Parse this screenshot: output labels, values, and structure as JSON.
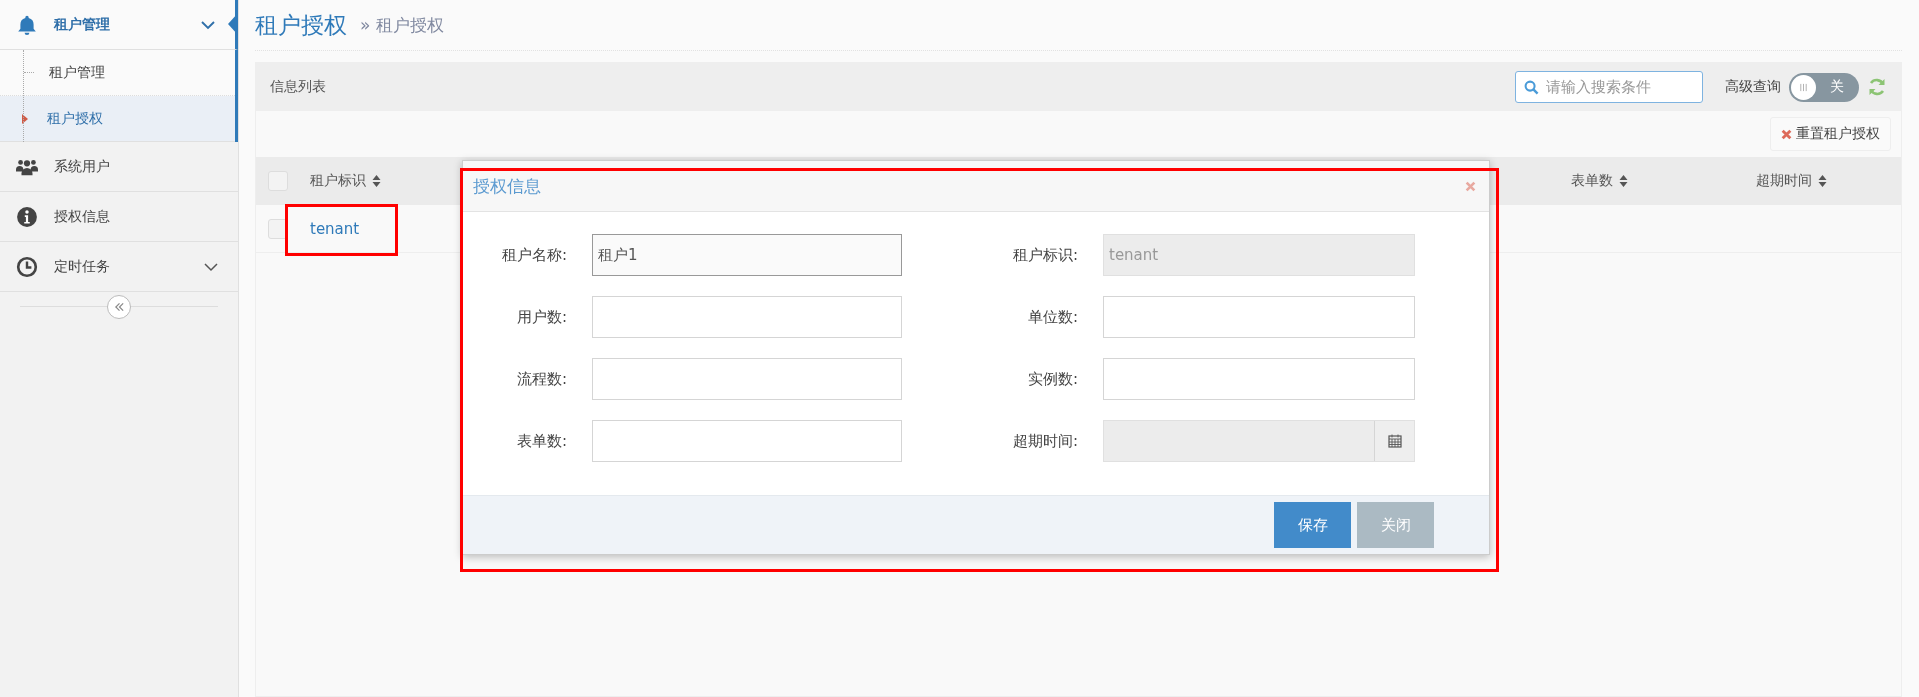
{
  "sidebar": {
    "items": [
      {
        "label": "租户管理",
        "kind": "bell",
        "selected": true,
        "expanded": true,
        "children": [
          {
            "label": "租户管理",
            "selected": false
          },
          {
            "label": "租户授权",
            "selected": true
          }
        ]
      },
      {
        "label": "系统用户",
        "kind": "users",
        "selected": false
      },
      {
        "label": "授权信息",
        "kind": "info",
        "selected": false
      },
      {
        "label": "定时任务",
        "kind": "clock",
        "selected": false,
        "expanded": false
      }
    ]
  },
  "page": {
    "title": "租户授权",
    "breadcrumb_separator": "»",
    "breadcrumb": "租户授权"
  },
  "panel": {
    "title": "信息列表",
    "search": {
      "placeholder": "请输入搜索条件"
    },
    "advanced_query": {
      "label": "高级查询",
      "on": false,
      "state_label": "关"
    },
    "reset_button": "重置租户授权"
  },
  "table": {
    "select_all": {
      "checked": false
    },
    "columns": [
      {
        "label": "租户标识"
      },
      {
        "label": "表单数"
      },
      {
        "label": "超期时间"
      }
    ],
    "rows": [
      {
        "selected": false,
        "cells": [
          "tenant"
        ]
      }
    ]
  },
  "dialog": {
    "title": "授权信息",
    "fields": [
      {
        "label": "租户名称:",
        "value": "租户1",
        "kind": "text",
        "disabled": false,
        "focused": true
      },
      {
        "label": "租户标识:",
        "value": "tenant",
        "kind": "text",
        "disabled": true,
        "focused": false
      },
      {
        "label": "用户数:",
        "kind": "text",
        "disabled": false,
        "focused": false
      },
      {
        "label": "单位数:",
        "kind": "text",
        "disabled": false,
        "focused": false
      },
      {
        "label": "流程数:",
        "kind": "text",
        "disabled": false,
        "focused": false
      },
      {
        "label": "实例数:",
        "kind": "text",
        "disabled": false,
        "focused": false
      },
      {
        "label": "表单数:",
        "kind": "text",
        "disabled": false,
        "focused": false
      },
      {
        "label": "超期时间:",
        "kind": "date",
        "disabled": true,
        "focused": false
      }
    ],
    "buttons": [
      {
        "label": "保存",
        "kind": "primary"
      },
      {
        "label": "关闭",
        "kind": "secondary"
      }
    ]
  }
}
